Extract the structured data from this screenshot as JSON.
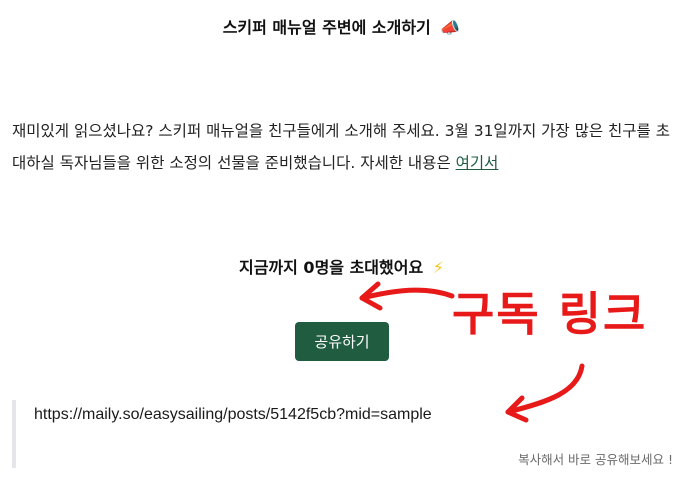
{
  "header": {
    "title": "스키퍼 매뉴얼 주변에 소개하기",
    "icon": "megaphone-icon",
    "icon_glyph": "📣"
  },
  "intro": {
    "text": "재미있게 읽으셨나요? 스키퍼 매뉴얼을 친구들에게 소개해 주세요. 3월 31일까지 가장 많은 친구를 초대하실 독자님들을 위한 소정의 선물을 준비했습니다. 자세한 내용은 ",
    "link_text": "여기서"
  },
  "invite": {
    "text": "지금까지 0명을 초대했어요",
    "icon": "lightning-icon",
    "icon_glyph": "⚡"
  },
  "share_button": {
    "label": "공유하기"
  },
  "share_link": {
    "url": "https://maily.so/easysailing/posts/5142f5cb?mid=sample"
  },
  "hint": {
    "text": "복사해서 바로 공유해보세요 !"
  },
  "annotation": {
    "text": "구독 링크"
  },
  "colors": {
    "accent": "#1f5c40",
    "link": "#1e5c40",
    "annotation": "#e81919"
  }
}
